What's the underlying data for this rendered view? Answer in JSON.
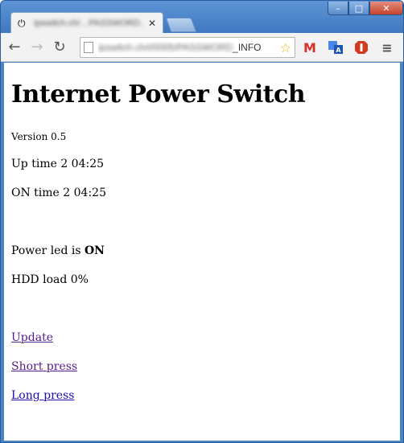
{
  "browser": {
    "tab_title": "Ipswitch.ch/…PASSWORD…",
    "tab_icon": "power-icon",
    "url_blurred": "ipswitch.ch/i/0005/PASSWORD",
    "url_suffix": "_INFO",
    "window_controls": {
      "minimize": "–",
      "maximize": "□",
      "close": "✕"
    },
    "extensions": [
      "gmail-icon",
      "translate-icon",
      "adblock-icon",
      "menu-icon"
    ]
  },
  "page": {
    "heading": "Internet Power Switch",
    "version": "Version 0.5",
    "uptime": "Up time 2 04:25",
    "ontime": "ON time 2 04:25",
    "power_led_prefix": "Power led is ",
    "power_led_state": "ON",
    "hdd_load": "HDD load 0%",
    "links": {
      "update": "Update",
      "short_press": "Short press",
      "long_press": "Long press"
    }
  },
  "colors": {
    "window_frame": "#4a84c8",
    "link_visited": "#551a8b",
    "link_unvisited": "#1a0dab"
  }
}
